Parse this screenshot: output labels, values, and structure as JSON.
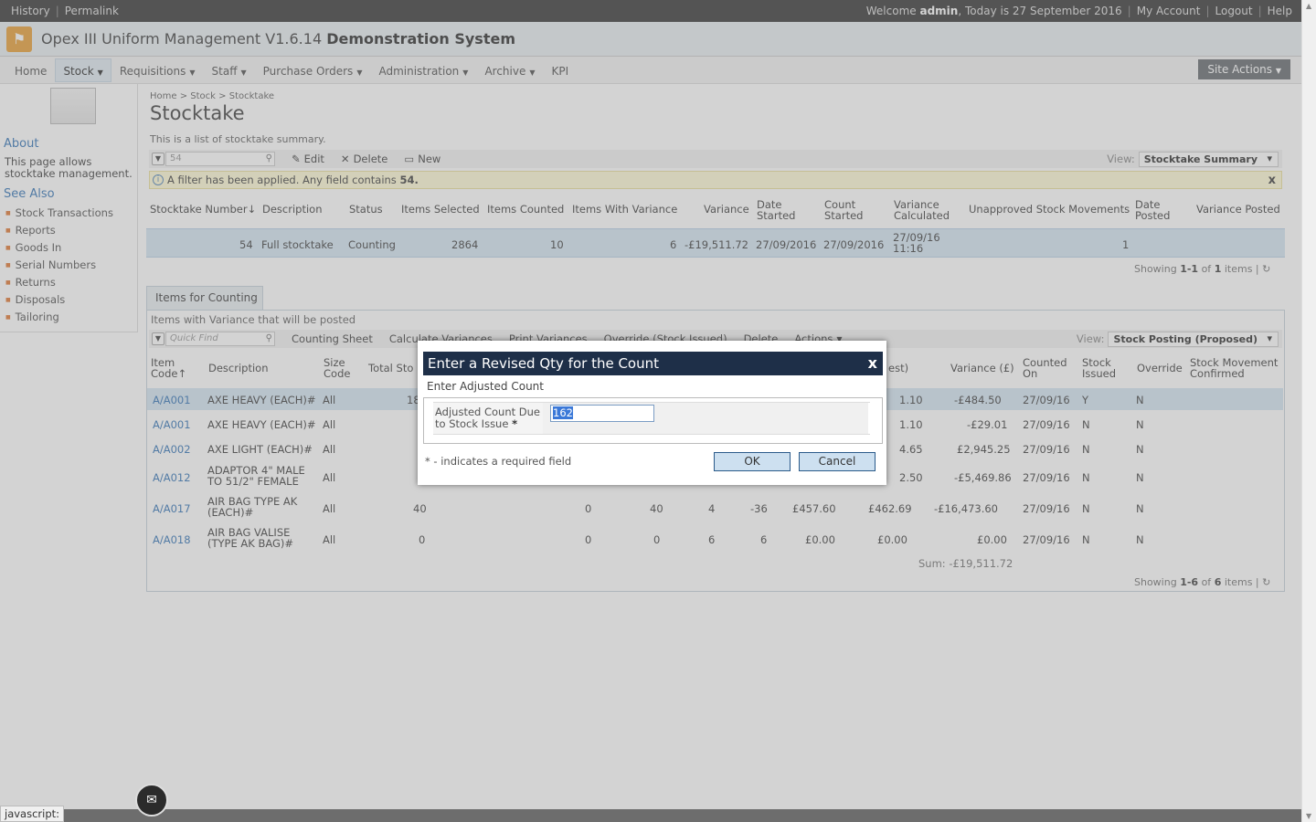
{
  "topbar": {
    "history": "History",
    "permalink": "Permalink",
    "welcome_prefix": "Welcome",
    "user": "admin",
    "today": ", Today is 27 September 2016",
    "my_account": "My Account",
    "logout": "Logout",
    "help": "Help"
  },
  "site": {
    "title_prefix": "Opex III Uniform Management V1.6.14",
    "title_bold": "Demonstration System"
  },
  "nav": {
    "items": [
      "Home",
      "Stock",
      "Requisitions",
      "Staff",
      "Purchase Orders",
      "Administration",
      "Archive",
      "KPI"
    ],
    "site_actions": "Site Actions"
  },
  "leftnav": {
    "about_heading": "About",
    "about_text": "This page allows stocktake management.",
    "see_also_heading": "See Also",
    "links": [
      "Stock Transactions",
      "Reports",
      "Goods In",
      "Serial Numbers",
      "Returns",
      "Disposals",
      "Tailoring"
    ]
  },
  "page": {
    "breadcrumb_home": "Home",
    "breadcrumb_stock": "Stock",
    "breadcrumb_current": "Stocktake",
    "title": "Stocktake",
    "description": "This is a list of stocktake summary."
  },
  "toolbar1": {
    "search_value": "54",
    "edit": "Edit",
    "delete": "Delete",
    "new": "New",
    "view_label": "View:",
    "view_value": "Stocktake Summary"
  },
  "filter": {
    "text": "A filter has been applied. Any field contains",
    "term": "54.",
    "close": "x"
  },
  "grid1": {
    "headers": [
      "Stocktake Number↓",
      "Description",
      "Status",
      "Items Selected",
      "Items Counted",
      "Items With Variance",
      "Variance",
      "Date Started",
      "Count Started",
      "Variance Calculated",
      "Unapproved Stock Movements",
      "Date Posted",
      "Variance Posted"
    ],
    "row": [
      "54",
      "Full stocktake",
      "Counting",
      "2864",
      "10",
      "6",
      "-£19,511.72",
      "27/09/2016",
      "27/09/2016",
      "27/09/16 11:16",
      "1"
    ],
    "pager_prefix": "Showing",
    "pager_range": "1-1",
    "pager_of": "of",
    "pager_total": "1",
    "pager_suffix": "items"
  },
  "tab": {
    "label": "Items for Counting",
    "panel_desc": "Items with Variance that will be posted"
  },
  "toolbar2": {
    "search_placeholder": "Quick Find",
    "counting_sheet": "Counting Sheet",
    "calculate_variances": "Calculate Variances",
    "print_variances": "Print Variances",
    "override": "Override (Stock Issued)",
    "delete": "Delete",
    "actions": "Actions",
    "view_label": "View:",
    "view_value": "Stock Posting (Proposed)"
  },
  "grid2": {
    "headers": {
      "item_code": "Item Code↑",
      "description": "Description",
      "size_code": "Size Code",
      "total_stock": "Total Sto",
      "cost": "est)",
      "variance": "Variance (£)",
      "counted_on": "Counted On",
      "stock_issued": "Stock Issued",
      "override": "Override",
      "confirmed": "Stock Movement Confirmed"
    },
    "rows": [
      {
        "code": "A/A001",
        "desc": "AXE HEAVY (EACH)#",
        "size": "All",
        "total": "18",
        "c1": "",
        "c2": "",
        "c3": "",
        "c4": "",
        "c5": "",
        "cost": "1.10",
        "variance": "-£484.50",
        "counted": "27/09/16",
        "issued": "Y",
        "override": "N"
      },
      {
        "code": "A/A001",
        "desc": "AXE HEAVY (EACH)#",
        "size": "All",
        "total": "",
        "c1": "",
        "c2": "",
        "c3": "",
        "c4": "",
        "c5": "",
        "cost": "1.10",
        "variance": "-£29.01",
        "counted": "27/09/16",
        "issued": "N",
        "override": "N"
      },
      {
        "code": "A/A002",
        "desc": "AXE LIGHT (EACH)#",
        "size": "All",
        "total": "",
        "c1": "",
        "c2": "",
        "c3": "",
        "c4": "",
        "c5": "",
        "cost": "4.65",
        "variance": "£2,945.25",
        "counted": "27/09/16",
        "issued": "N",
        "override": "N"
      },
      {
        "code": "A/A012",
        "desc": "ADAPTOR 4\" MALE TO 51/2\" FEMALE",
        "size": "All",
        "total": "",
        "c1": "",
        "c2": "",
        "c3": "",
        "c4": "",
        "c5": "",
        "cost": "2.50",
        "variance": "-£5,469.86",
        "counted": "27/09/16",
        "issued": "N",
        "override": "N"
      },
      {
        "code": "A/A017",
        "desc": "AIR BAG TYPE AK (EACH)#",
        "size": "All",
        "total": "40",
        "c1": "0",
        "c2": "40",
        "c3": "4",
        "c4": "-36",
        "c5": "£457.60",
        "cost": "£462.69",
        "variance": "-£16,473.60",
        "counted": "27/09/16",
        "issued": "N",
        "override": "N"
      },
      {
        "code": "A/A018",
        "desc": "AIR BAG VALISE (TYPE AK BAG)#",
        "size": "All",
        "total": "0",
        "c1": "0",
        "c2": "0",
        "c3": "6",
        "c4": "6",
        "c5": "£0.00",
        "cost": "£0.00",
        "variance": "£0.00",
        "counted": "27/09/16",
        "issued": "N",
        "override": "N"
      }
    ],
    "sum": "Sum: -£19,511.72",
    "pager_prefix": "Showing",
    "pager_range": "1-6",
    "pager_of": "of",
    "pager_total": "6",
    "pager_suffix": "items"
  },
  "dialog": {
    "title": "Enter a Revised Qty for the Count",
    "close": "x",
    "subtitle": "Enter Adjusted Count",
    "field_label": "Adjusted Count Due to Stock Issue",
    "required_mark": "*",
    "field_value": "162",
    "required_note": "* - indicates a required field",
    "ok": "OK",
    "cancel": "Cancel"
  },
  "status": {
    "text": "javascript:"
  }
}
